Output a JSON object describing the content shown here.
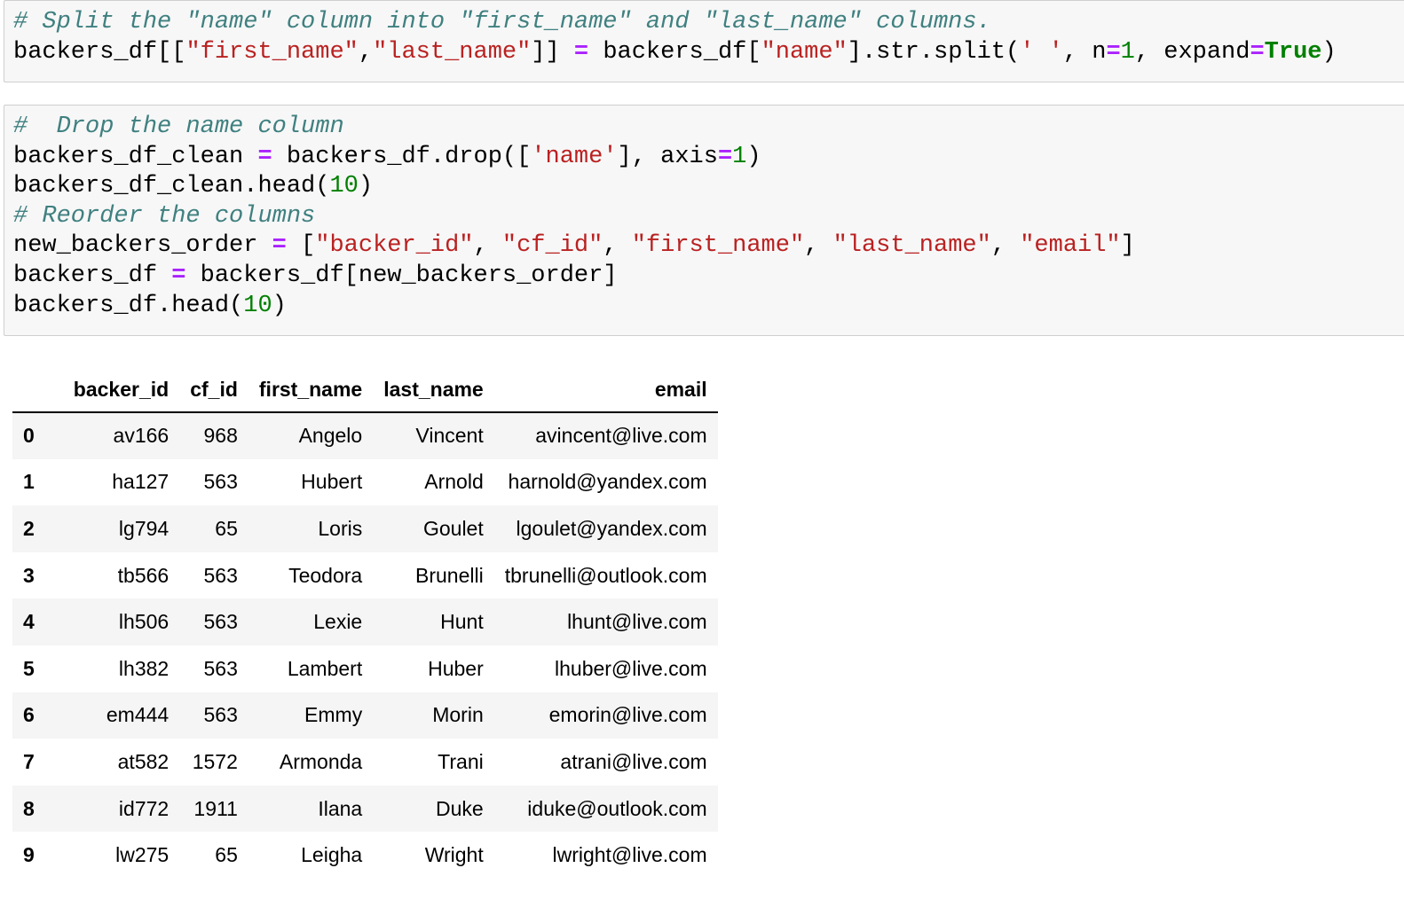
{
  "cells": [
    {
      "lines": [
        [
          [
            "c",
            "# Split the \"name\" column into \"first_name\" and \"last_name\" columns."
          ]
        ],
        [
          [
            "",
            "backers_df[["
          ],
          [
            "s",
            "\"first_name\""
          ],
          [
            "",
            ","
          ],
          [
            "s",
            "\"last_name\""
          ],
          [
            "",
            "]] "
          ],
          [
            "o",
            "="
          ],
          [
            "",
            " backers_df["
          ],
          [
            "s",
            "\"name\""
          ],
          [
            "",
            "].str.split("
          ],
          [
            "s",
            "' '"
          ],
          [
            "",
            ", n"
          ],
          [
            "o",
            "="
          ],
          [
            "n",
            "1"
          ],
          [
            "",
            ", expand"
          ],
          [
            "o",
            "="
          ],
          [
            "k",
            "True"
          ],
          [
            "",
            ")"
          ]
        ]
      ]
    },
    {
      "lines": [
        [
          [
            "c",
            "#  Drop the name column"
          ]
        ],
        [
          [
            "",
            "backers_df_clean "
          ],
          [
            "o",
            "="
          ],
          [
            "",
            " backers_df.drop(["
          ],
          [
            "s",
            "'name'"
          ],
          [
            "",
            "], axis"
          ],
          [
            "o",
            "="
          ],
          [
            "n",
            "1"
          ],
          [
            "",
            ")"
          ]
        ],
        [
          [
            "",
            "backers_df_clean.head("
          ],
          [
            "n",
            "10"
          ],
          [
            "",
            ")"
          ]
        ],
        [
          [
            "c",
            "# Reorder the columns"
          ]
        ],
        [
          [
            "",
            "new_backers_order "
          ],
          [
            "o",
            "="
          ],
          [
            "",
            " ["
          ],
          [
            "s",
            "\"backer_id\""
          ],
          [
            "",
            ", "
          ],
          [
            "s",
            "\"cf_id\""
          ],
          [
            "",
            ", "
          ],
          [
            "s",
            "\"first_name\""
          ],
          [
            "",
            ", "
          ],
          [
            "s",
            "\"last_name\""
          ],
          [
            "",
            ", "
          ],
          [
            "s",
            "\"email\""
          ],
          [
            "",
            "]"
          ]
        ],
        [
          [
            "",
            "backers_df "
          ],
          [
            "o",
            "="
          ],
          [
            "",
            " backers_df[new_backers_order]"
          ]
        ],
        [
          [
            "",
            "backers_df.head("
          ],
          [
            "n",
            "10"
          ],
          [
            "",
            ")"
          ]
        ]
      ]
    }
  ],
  "table": {
    "columns": [
      "backer_id",
      "cf_id",
      "first_name",
      "last_name",
      "email"
    ],
    "rows": [
      {
        "index": "0",
        "values": [
          "av166",
          "968",
          "Angelo",
          "Vincent",
          "avincent@live.com"
        ]
      },
      {
        "index": "1",
        "values": [
          "ha127",
          "563",
          "Hubert",
          "Arnold",
          "harnold@yandex.com"
        ]
      },
      {
        "index": "2",
        "values": [
          "lg794",
          "65",
          "Loris",
          "Goulet",
          "lgoulet@yandex.com"
        ]
      },
      {
        "index": "3",
        "values": [
          "tb566",
          "563",
          "Teodora",
          "Brunelli",
          "tbrunelli@outlook.com"
        ]
      },
      {
        "index": "4",
        "values": [
          "lh506",
          "563",
          "Lexie",
          "Hunt",
          "lhunt@live.com"
        ]
      },
      {
        "index": "5",
        "values": [
          "lh382",
          "563",
          "Lambert",
          "Huber",
          "lhuber@live.com"
        ]
      },
      {
        "index": "6",
        "values": [
          "em444",
          "563",
          "Emmy",
          "Morin",
          "emorin@live.com"
        ]
      },
      {
        "index": "7",
        "values": [
          "at582",
          "1572",
          "Armonda",
          "Trani",
          "atrani@live.com"
        ]
      },
      {
        "index": "8",
        "values": [
          "id772",
          "1911",
          "Ilana",
          "Duke",
          "iduke@outlook.com"
        ]
      },
      {
        "index": "9",
        "values": [
          "lw275",
          "65",
          "Leigha",
          "Wright",
          "lwright@live.com"
        ]
      }
    ]
  }
}
